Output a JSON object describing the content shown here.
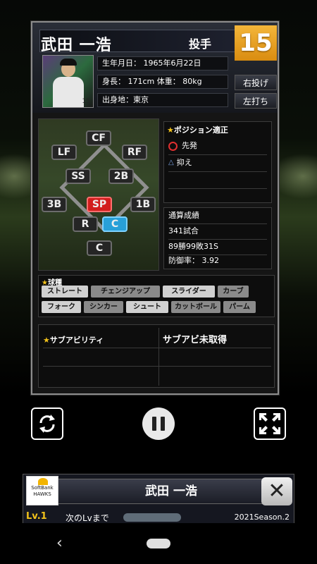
{
  "player": {
    "name": "武田 一浩",
    "position": "投手",
    "number": "15",
    "throws": "右投げ",
    "bats": "左打ち",
    "photo_number": "15"
  },
  "info": {
    "birthday": "生年月日： 1965年6月22日",
    "physique": "身長： 171cm 体重： 80kg",
    "hometown": "出身地：東京"
  },
  "field_positions": {
    "cf": "CF",
    "lf": "LF",
    "rf": "RF",
    "ss": "SS",
    "second": "2B",
    "third": "3B",
    "pitcher": "SP",
    "first": "1B",
    "relief": "R",
    "catcher_sub": "C",
    "catcher": "C"
  },
  "aptitude": {
    "title": "★ポジション適正",
    "items": [
      {
        "mark": "circle",
        "label": "先発"
      },
      {
        "mark": "triangle",
        "label": "抑え"
      }
    ]
  },
  "career": {
    "title": "通算成績",
    "games": "341試合",
    "record": "89勝99敗31S",
    "era": "防御率： 3.92"
  },
  "pitches": {
    "title": "★球種",
    "items": [
      {
        "label": "ストレート",
        "active": true
      },
      {
        "label": "チェンジアップ",
        "active": false
      },
      {
        "label": "スライダー",
        "active": true
      },
      {
        "label": "カーブ",
        "active": false
      },
      {
        "label": "フォーク",
        "active": true
      },
      {
        "label": "シンカー",
        "active": false
      },
      {
        "label": "シュート",
        "active": true
      },
      {
        "label": "カットボール",
        "active": false
      },
      {
        "label": "パーム",
        "active": false
      }
    ]
  },
  "sub_ability": {
    "title": "★サブアビリティ",
    "value": "サブアビ未取得"
  },
  "controls": {
    "rotate_icon": "rotate-icon",
    "pause_icon": "pause-icon",
    "collapse_icon": "collapse-icon"
  },
  "bottom": {
    "team_logo_text": "SoftBank HAWKS",
    "name": "武田 一浩",
    "close_label": "✕",
    "level": "Lv.1",
    "next_level_label": "次のLvまで",
    "season": "2021Season.2"
  },
  "colors": {
    "number_bg": "#e9a224",
    "pitcher_pos": "#d21e1e",
    "catcher_sub": "#28a0d8",
    "accent_star": "#f2c21a"
  }
}
